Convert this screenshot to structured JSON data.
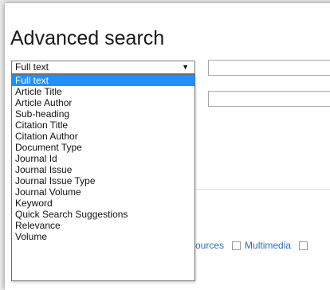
{
  "page": {
    "title": "Advanced search"
  },
  "search_field": {
    "selected": "Full text",
    "arrow": "▼",
    "options": [
      "Full text",
      "Article Title",
      "Article Author",
      "Sub-heading",
      "Citation Title",
      "Citation Author",
      "Document Type",
      "Journal Id",
      "Journal Issue",
      "Journal Issue Type",
      "Journal Volume",
      "Keyword",
      "Quick Search Suggestions",
      "Relevance",
      "Volume"
    ]
  },
  "filters": {
    "sources_label": "ources",
    "multimedia_label": "Multimedia"
  },
  "colors": {
    "selected_option_bg": "#1e90ff",
    "link_text": "#2d6fb7"
  }
}
